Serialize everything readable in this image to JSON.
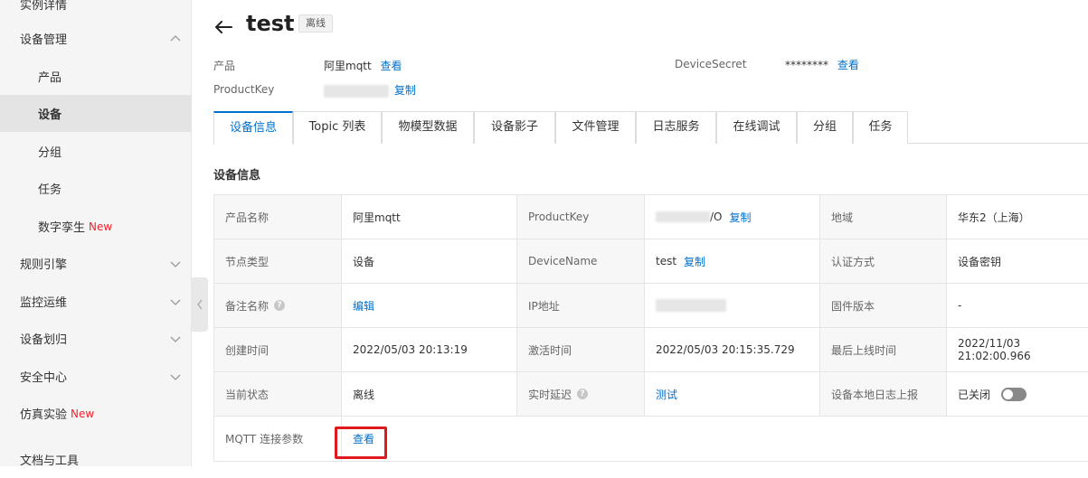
{
  "sidebar": {
    "items": [
      {
        "label": "实例详情",
        "level": "top",
        "chevron": "none"
      },
      {
        "label": "设备管理",
        "level": "top",
        "chevron": "up"
      },
      {
        "label": "产品",
        "level": "sub"
      },
      {
        "label": "设备",
        "level": "sub",
        "active": true
      },
      {
        "label": "分组",
        "level": "sub"
      },
      {
        "label": "任务",
        "level": "sub"
      },
      {
        "label": "数字孪生",
        "level": "sub",
        "badge": "New"
      },
      {
        "label": "规则引擎",
        "level": "top",
        "chevron": "down"
      },
      {
        "label": "监控运维",
        "level": "top",
        "chevron": "down"
      },
      {
        "label": "设备划归",
        "level": "top",
        "chevron": "down"
      },
      {
        "label": "安全中心",
        "level": "top",
        "chevron": "down"
      },
      {
        "label": "仿真实验",
        "level": "top",
        "badge": "New"
      },
      {
        "label": "文档与工具",
        "level": "top"
      }
    ]
  },
  "header": {
    "title": "test",
    "status": "离线"
  },
  "meta": {
    "product_label": "产品",
    "product_value": "阿里mqtt",
    "product_link": "查看",
    "secret_label": "DeviceSecret",
    "secret_value": "********",
    "secret_link": "查看",
    "productkey_label": "ProductKey",
    "productkey_link": "复制"
  },
  "tabs": [
    {
      "label": "设备信息",
      "active": true
    },
    {
      "label": "Topic 列表"
    },
    {
      "label": "物模型数据"
    },
    {
      "label": "设备影子"
    },
    {
      "label": "文件管理"
    },
    {
      "label": "日志服务"
    },
    {
      "label": "在线调试"
    },
    {
      "label": "分组"
    },
    {
      "label": "任务"
    }
  ],
  "section_title": "设备信息",
  "info": {
    "r1": {
      "k1": "产品名称",
      "v1": "阿里mqtt",
      "k2": "ProductKey",
      "v2_suffix": "/O",
      "v2_link": "复制",
      "k3": "地域",
      "v3": "华东2（上海）"
    },
    "r2": {
      "k1": "节点类型",
      "v1": "设备",
      "k2": "DeviceName",
      "v2": "test",
      "v2_link": "复制",
      "k3": "认证方式",
      "v3": "设备密钥"
    },
    "r3": {
      "k1": "备注名称",
      "v1_link": "编辑",
      "k2": "IP地址",
      "k3": "固件版本",
      "v3": "-"
    },
    "r4": {
      "k1": "创建时间",
      "v1": "2022/05/03 20:13:19",
      "k2": "激活时间",
      "v2": "2022/05/03 20:15:35.729",
      "k3": "最后上线时间",
      "v3": "2022/11/03 21:02:00.966"
    },
    "r5": {
      "k1": "当前状态",
      "v1": "离线",
      "k2": "实时延迟",
      "v2_link": "测试",
      "k3": "设备本地日志上报",
      "v3": "已关闭"
    },
    "r6": {
      "k1": "MQTT 连接参数",
      "v1_link": "查看"
    }
  },
  "colors": {
    "accent": "#0070cc",
    "highlight": "#e0191f",
    "new_badge": "#f5222d"
  }
}
